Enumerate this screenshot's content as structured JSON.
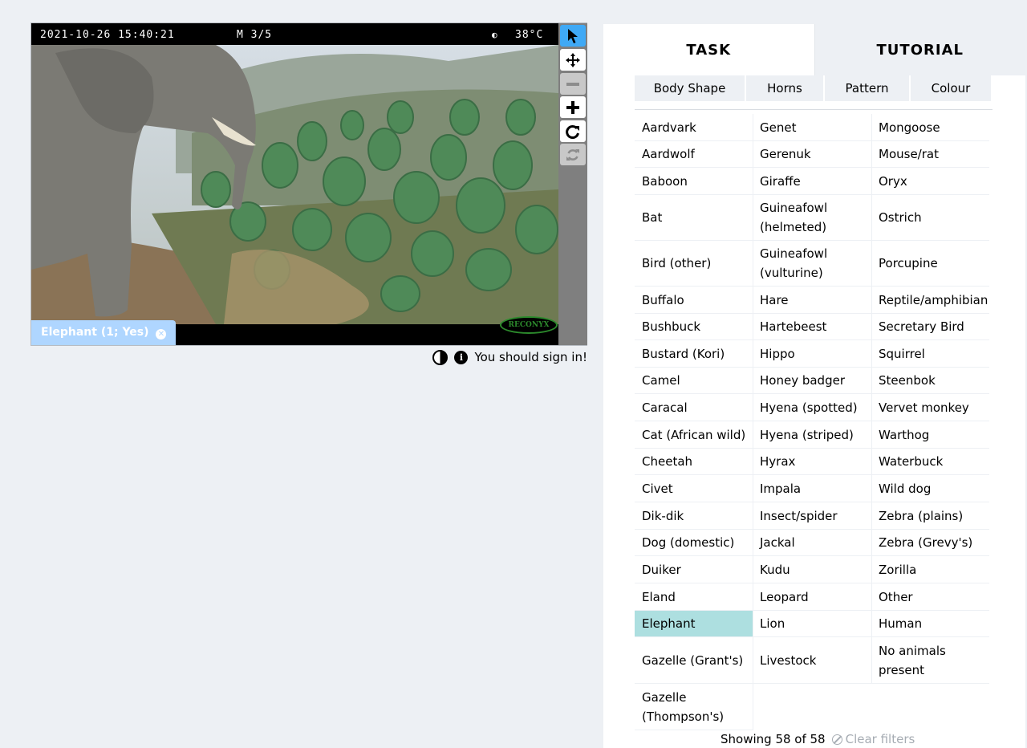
{
  "viewer": {
    "stamp_date": "2021-10-26 15:40:21",
    "stamp_mode": "M 3/5",
    "stamp_moon": "◐",
    "stamp_temp": "38°C",
    "camera_brand": "RECONYX",
    "annotation_label": "Elephant (1; Yes)",
    "tools": [
      "pointer-tool",
      "move-tool",
      "zoom-out-tool",
      "zoom-in-tool",
      "rotate-tool",
      "reset-tool"
    ]
  },
  "below_viewer": {
    "sign_in_text": "You should sign in!"
  },
  "panel": {
    "tabs": [
      "TASK",
      "TUTORIAL"
    ],
    "filters": [
      "Body Shape",
      "Horns",
      "Pattern",
      "Colour"
    ],
    "columns": [
      [
        "Aardvark",
        "Aardwolf",
        "Baboon",
        "Bat",
        "Bird (other)",
        "Buffalo",
        "Bushbuck",
        "Bustard (Kori)",
        "Camel",
        "Caracal",
        "Cat (African wild)",
        "Cheetah",
        "Civet",
        "Dik-dik",
        "Dog (domestic)",
        "Duiker",
        "Eland",
        "Elephant",
        "Gazelle (Grant's)",
        "Gazelle (Thompson's)"
      ],
      [
        "Genet",
        "Gerenuk",
        "Giraffe",
        "Guineafowl (helmeted)",
        "Guineafowl (vulturine)",
        "Hare",
        "Hartebeest",
        "Hippo",
        "Honey badger",
        "Hyena (spotted)",
        "Hyena (striped)",
        "Hyrax",
        "Impala",
        "Insect/spider",
        "Jackal",
        "Kudu",
        "Leopard",
        "Lion",
        "Livestock"
      ],
      [
        "Mongoose",
        "Mouse/rat",
        "Oryx",
        "Ostrich",
        "Porcupine",
        "Reptile/amphibian",
        "Secretary Bird",
        "Squirrel",
        "Steenbok",
        "Vervet monkey",
        "Warthog",
        "Waterbuck",
        "Wild dog",
        "Zebra (plains)",
        "Zebra (Grevy's)",
        "Zorilla",
        "Other",
        "Human",
        "No animals present"
      ]
    ],
    "selected_choice": "Elephant",
    "footer": {
      "showing": "Showing 58 of 58",
      "clear": "Clear filters"
    }
  }
}
